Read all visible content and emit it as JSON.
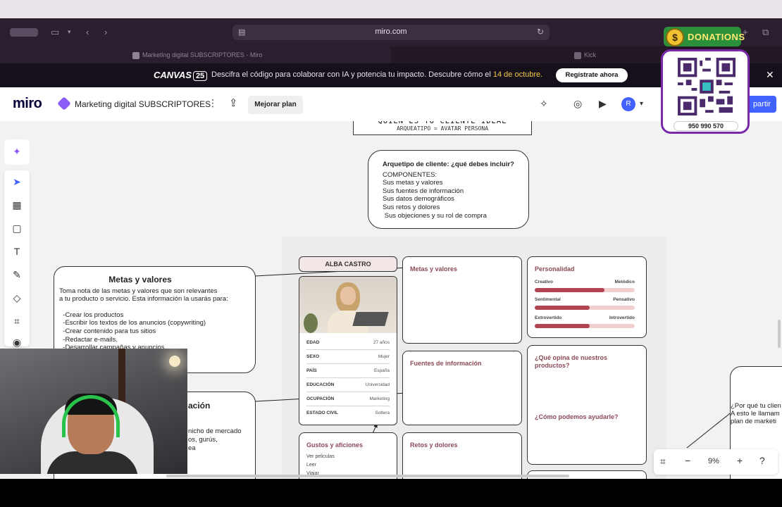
{
  "browser": {
    "url": "miro.com",
    "tabs": [
      {
        "label": "Marketing digital SUBSCRIPTORES - Miro"
      },
      {
        "label": "Kick"
      }
    ]
  },
  "banner": {
    "logo": "CANVAS",
    "logo_badge": "25",
    "text_main": "Descifra el código para colaborar con IA y potencia tu impacto. Descubre cómo el ",
    "text_date": "14 de octubre.",
    "button": "Regístrate ahora"
  },
  "miro": {
    "logo": "miro",
    "board_title": "Marketing digital SUBSCRIPTORES",
    "upgrade": "Mejorar plan",
    "avatar_initial": "R",
    "share": "partir",
    "zoom": "9%"
  },
  "board": {
    "title_main": "QUIEN ES TU CLIENTE IDEAL",
    "title_sub": "ARQUEATIPO = AVATAR PERSONA",
    "arquetipo": {
      "heading": "Arquetipo de cliente: ¿qué debes incluir?",
      "lines": [
        "COMPONENTES:",
        "Sus metas y valores",
        "Sus fuentes de información",
        "Sus datos demográficos",
        "Sus retos y dolores",
        " Sus objeciones y su rol de compra"
      ]
    },
    "metas": {
      "heading": "Metas y valores",
      "intro1": "Toma nota de las metas y valores que son relevantes",
      "intro2": "a tu producto o servicio. Esta información la usarás para:",
      "items": [
        "  -Crear los productos",
        "  -Escribir los textos de los anuncios (copywriting)",
        "  -Crear contenido para tus sitios",
        "  -Redactar e-mails.",
        "  -Desarrollar campañas y anuncios"
      ]
    },
    "conocimiento": {
      "heading_fragment": "ación",
      "line1": "nicho de mercado",
      "line2": "os, gurús,",
      "line3": "ea"
    },
    "persona": {
      "name": "ALBA CASTRO",
      "rows": [
        {
          "k": "EDAD",
          "v": "27 años"
        },
        {
          "k": "SEXO",
          "v": "Mujer"
        },
        {
          "k": "PAÍS",
          "v": "España"
        },
        {
          "k": "EDUCACIÓN",
          "v": "Universidad"
        },
        {
          "k": "OCUPACIÓN",
          "v": "Marketing"
        },
        {
          "k": "ESTADO CIVIL",
          "v": "Soltera"
        }
      ]
    },
    "cards": {
      "metas_valores": "Metas y valores",
      "fuentes": "Fuentes de información",
      "retos": "Retos y dolores",
      "opina": "¿Qué opina de nuestros productos?",
      "ayudarle": "¿Cómo podemos ayudarle?",
      "gustos": "Gustos y aficiones"
    },
    "gustos_items": [
      "Ver peliculas",
      "Leer",
      "Viajar"
    ],
    "personalidad": {
      "heading": "Personalidad",
      "traits": [
        {
          "left": "Creativo",
          "right": "Metódico",
          "level": 0.7
        },
        {
          "left": "Sentimental",
          "right": "Pensativo",
          "level": 0.55
        },
        {
          "left": "Extrovertido",
          "right": "Introvertido",
          "level": 0.55
        }
      ]
    },
    "right_partial": {
      "line1": "¿Por qué tu clien",
      "line2": "A esto le llamam",
      "line3": "plan de marketi"
    }
  },
  "donation": {
    "label": "DONATIONS",
    "coin": "$",
    "phone": "950 990 570"
  },
  "colors": {
    "miro_blue": "#4262ff",
    "accent_text": "#8b4a55",
    "trait_bar": "#b0444f",
    "banner_date": "#f2c94c"
  }
}
